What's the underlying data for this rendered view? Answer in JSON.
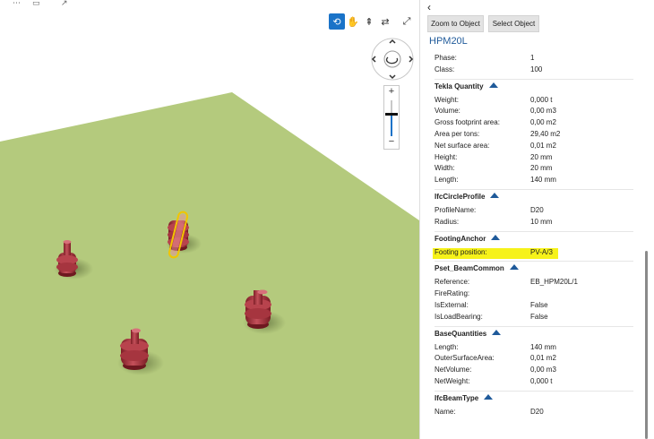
{
  "viewport": {
    "plane_color": "#b4ca7d",
    "toolbar": {
      "orbit_icon": "orbit-icon",
      "pan_icon": "hand-icon",
      "walk_icon": "walk-icon",
      "swap_icon": "swap-arrows-icon",
      "fullscreen_icon": "expand-icon"
    },
    "zoom": {
      "plus": "+",
      "minus": "−"
    }
  },
  "panel": {
    "back_icon": "chevron-left-icon",
    "buttons": {
      "zoom_to_object": "Zoom to Object",
      "select_object": "Select Object"
    },
    "title": "HPM20L",
    "top_rows": [
      {
        "key": "Phase:",
        "value": "1"
      },
      {
        "key": "Class:",
        "value": "100"
      }
    ],
    "sections": [
      {
        "name": "Tekla Quantity",
        "rows": [
          {
            "key": "Weight:",
            "value": "0,000 t"
          },
          {
            "key": "Volume:",
            "value": "0,00 m3"
          },
          {
            "key": "Gross footprint area:",
            "value": "0,00 m2"
          },
          {
            "key": "Area per tons:",
            "value": "29,40 m2"
          },
          {
            "key": "Net surface area:",
            "value": "0,01 m2"
          },
          {
            "key": "Height:",
            "value": "20 mm"
          },
          {
            "key": "Width:",
            "value": "20 mm"
          },
          {
            "key": "Length:",
            "value": "140 mm"
          }
        ]
      },
      {
        "name": "IfcCircleProfile",
        "rows": [
          {
            "key": "ProfileName:",
            "value": "D20"
          },
          {
            "key": "Radius:",
            "value": "10 mm"
          }
        ]
      },
      {
        "name": "FootingAnchor",
        "rows": [
          {
            "key": "Footing position:",
            "value": "PV-A/3",
            "highlight": true
          }
        ]
      },
      {
        "name": "Pset_BeamCommon",
        "rows": [
          {
            "key": "Reference:",
            "value": "EB_HPM20L/1"
          },
          {
            "key": "FireRating:",
            "value": ""
          },
          {
            "key": "IsExternal:",
            "value": "False"
          },
          {
            "key": "IsLoadBearing:",
            "value": "False"
          }
        ]
      },
      {
        "name": "BaseQuantities",
        "rows": [
          {
            "key": "Length:",
            "value": "140 mm"
          },
          {
            "key": "OuterSurfaceArea:",
            "value": "0,01 m2"
          },
          {
            "key": "NetVolume:",
            "value": "0,00 m3"
          },
          {
            "key": "NetWeight:",
            "value": "0,000 t"
          }
        ]
      },
      {
        "name": "IfcBeamType",
        "rows": [
          {
            "key": "Name:",
            "value": "D20"
          }
        ]
      }
    ]
  }
}
